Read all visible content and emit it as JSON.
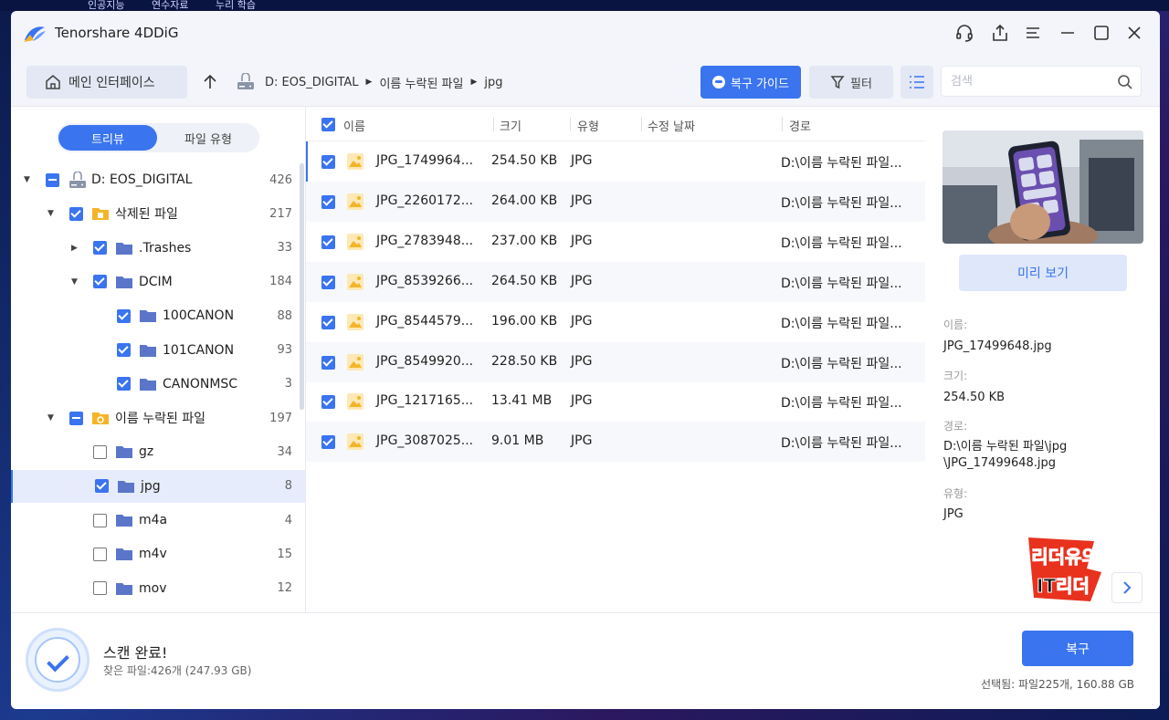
{
  "desktop": {
    "top_labels": [
      "인공지능",
      "연수자료",
      "누리 학습"
    ]
  },
  "app": {
    "title": "Tenorshare 4DDiG"
  },
  "toolbar": {
    "home_label": "메인 인터페이스",
    "path": [
      "D: EOS_DIGITAL",
      "이름 누락된 파일",
      "jpg"
    ],
    "guide_label": "복구 가이드",
    "filter_label": "필터",
    "search_placeholder": "검색"
  },
  "sidebar": {
    "tabs": [
      "트리뷰",
      "파일 유형"
    ],
    "items": [
      {
        "label": "D: EOS_DIGITAL",
        "count": "426",
        "level": 0,
        "expand": "open",
        "check": "partial",
        "icon": "drive-icon"
      },
      {
        "label": "삭제된 파일",
        "count": "217",
        "level": 1,
        "expand": "open",
        "check": "checked",
        "icon": "deleted-folder-icon"
      },
      {
        "label": ".Trashes",
        "count": "33",
        "level": 2,
        "expand": "closed",
        "check": "checked",
        "icon": "folder-icon"
      },
      {
        "label": "DCIM",
        "count": "184",
        "level": 2,
        "expand": "open",
        "check": "checked",
        "icon": "folder-icon"
      },
      {
        "label": "100CANON",
        "count": "88",
        "level": 3,
        "expand": "none",
        "check": "checked",
        "icon": "folder-icon"
      },
      {
        "label": "101CANON",
        "count": "93",
        "level": 3,
        "expand": "none",
        "check": "checked",
        "icon": "folder-icon"
      },
      {
        "label": "CANONMSC",
        "count": "3",
        "level": 3,
        "expand": "none",
        "check": "checked",
        "icon": "folder-icon"
      },
      {
        "label": "이름 누락된 파일",
        "count": "197",
        "level": 1,
        "expand": "open",
        "check": "partial",
        "icon": "lost-folder-icon"
      },
      {
        "label": "gz",
        "count": "34",
        "level": 2,
        "expand": "none",
        "check": "empty",
        "icon": "folder-icon"
      },
      {
        "label": "jpg",
        "count": "8",
        "level": 2,
        "expand": "none",
        "check": "checked",
        "icon": "folder-icon",
        "selected": true
      },
      {
        "label": "m4a",
        "count": "4",
        "level": 2,
        "expand": "none",
        "check": "empty",
        "icon": "folder-icon"
      },
      {
        "label": "m4v",
        "count": "15",
        "level": 2,
        "expand": "none",
        "check": "empty",
        "icon": "folder-icon"
      },
      {
        "label": "mov",
        "count": "12",
        "level": 2,
        "expand": "none",
        "check": "empty",
        "icon": "folder-icon"
      }
    ]
  },
  "filelist": {
    "columns": [
      "이름",
      "크기",
      "유형",
      "수정 날짜",
      "경로"
    ],
    "rows": [
      {
        "name": "JPG_1749964...",
        "size": "254.50 KB",
        "type": "JPG",
        "date": "",
        "path": "D:\\이름 누락된 파일..."
      },
      {
        "name": "JPG_2260172...",
        "size": "264.00 KB",
        "type": "JPG",
        "date": "",
        "path": "D:\\이름 누락된 파일..."
      },
      {
        "name": "JPG_2783948...",
        "size": "237.00 KB",
        "type": "JPG",
        "date": "",
        "path": "D:\\이름 누락된 파일..."
      },
      {
        "name": "JPG_8539266...",
        "size": "264.50 KB",
        "type": "JPG",
        "date": "",
        "path": "D:\\이름 누락된 파일..."
      },
      {
        "name": "JPG_8544579...",
        "size": "196.00 KB",
        "type": "JPG",
        "date": "",
        "path": "D:\\이름 누락된 파일..."
      },
      {
        "name": "JPG_8549920...",
        "size": "228.50 KB",
        "type": "JPG",
        "date": "",
        "path": "D:\\이름 누락된 파일..."
      },
      {
        "name": "JPG_1217165...",
        "size": "13.41 MB",
        "type": "JPG",
        "date": "",
        "path": "D:\\이름 누락된 파일..."
      },
      {
        "name": "JPG_3087025...",
        "size": "9.01 MB",
        "type": "JPG",
        "date": "",
        "path": "D:\\이름 누락된 파일..."
      }
    ]
  },
  "preview": {
    "button_label": "미리 보기",
    "name_key": "이름:",
    "name_value": "JPG_17499648.jpg",
    "size_key": "크기:",
    "size_value": "254.50 KB",
    "path_key": "경로:",
    "path_value_1": "D:\\이름 누락된 파일\\jpg",
    "path_value_2": "\\JPG_17499648.jpg",
    "type_key": "유형:",
    "type_value": "JPG",
    "watermark_line1": "리더유의",
    "watermark_line2": "IT리더"
  },
  "footer": {
    "scan_title": "스캔 완료!",
    "scan_sub": "찾은 파일:426개 (247.93 GB)",
    "recover_label": "복구",
    "selected_info": "선택됨: 파일225개, 160.88 GB"
  },
  "colors": {
    "accent": "#3a74ef",
    "folder": "#5b76c9",
    "deleted_folder": "#f5b428",
    "image_icon": "#f5b428"
  }
}
